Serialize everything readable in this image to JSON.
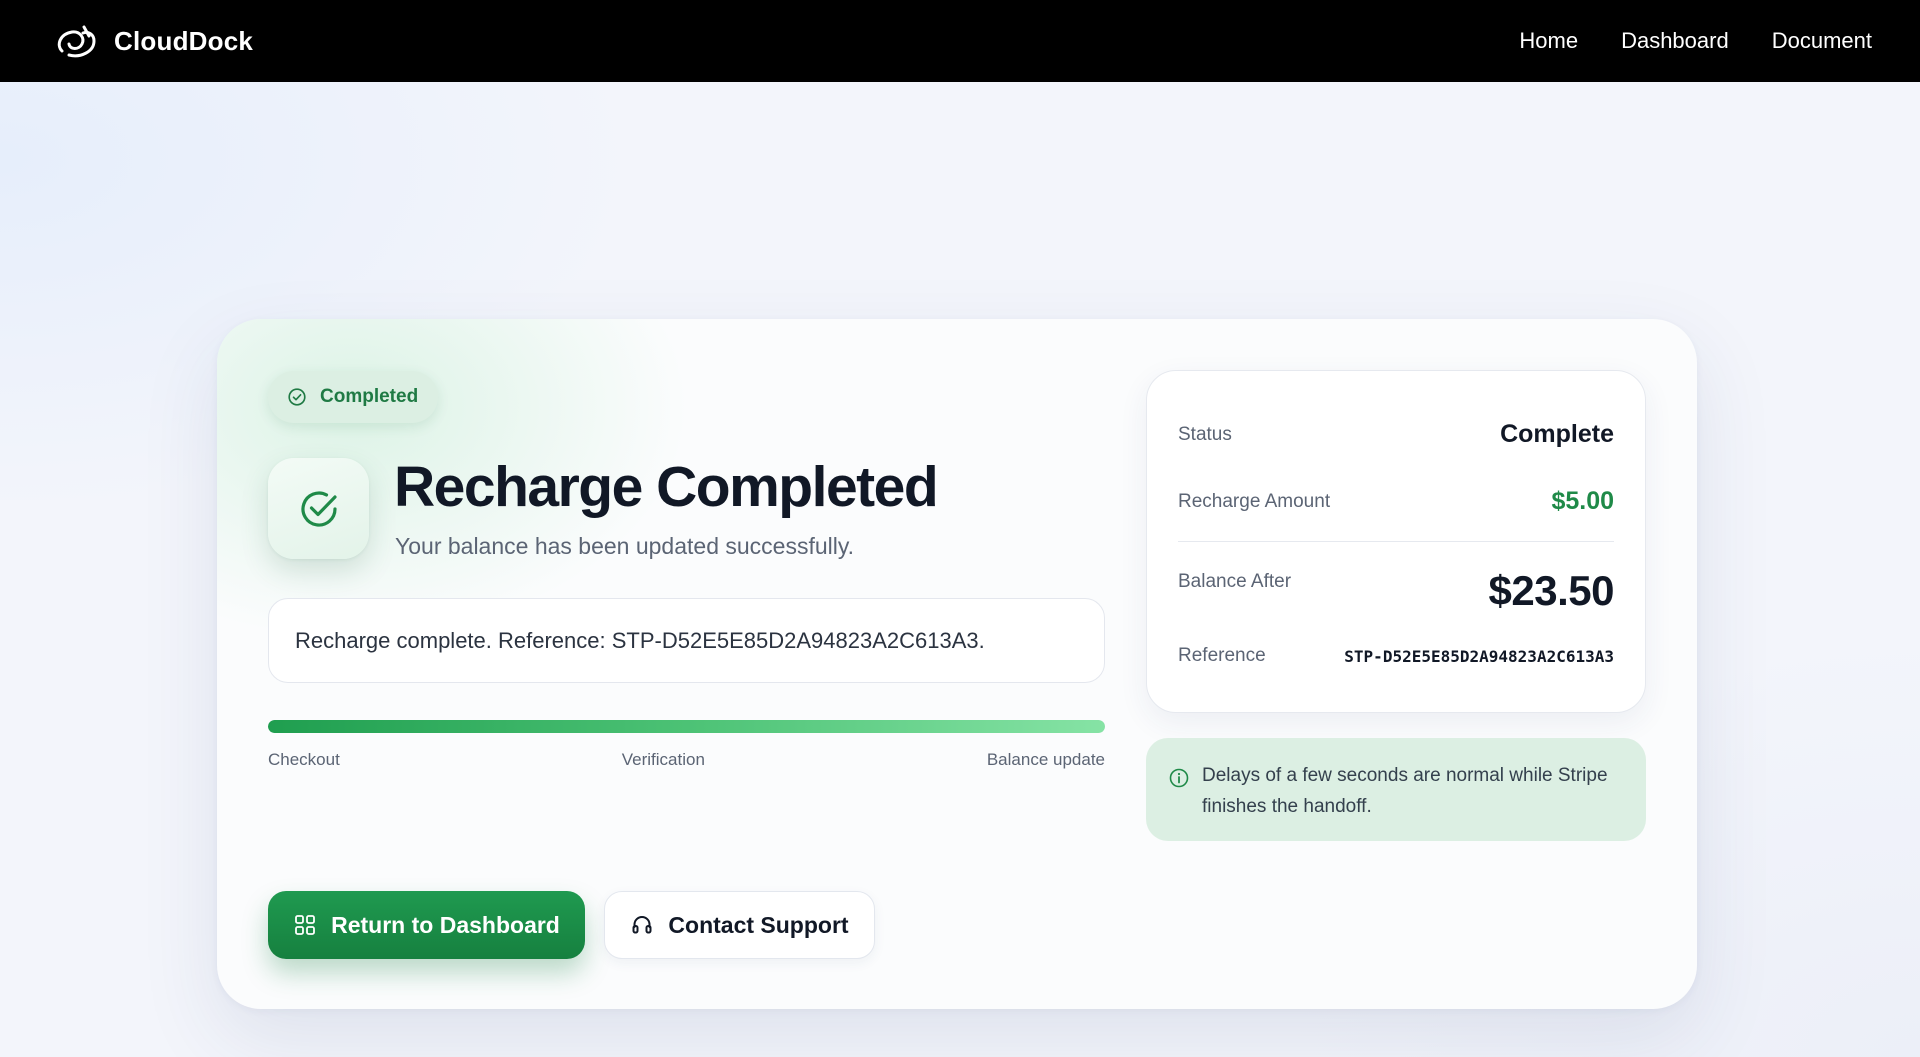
{
  "nav": {
    "brand": "CloudDock",
    "links": [
      "Home",
      "Dashboard",
      "Document"
    ]
  },
  "status_badge": {
    "label": "Completed",
    "icon": "check-circle-icon"
  },
  "hero": {
    "icon": "check-circle-icon",
    "title": "Recharge Completed",
    "subtitle": "Your balance has been updated successfully."
  },
  "message": "Recharge complete. Reference: STP-D52E5E85D2A94823A2C613A3.",
  "progress": {
    "percent": 100,
    "steps": [
      "Checkout",
      "Verification",
      "Balance update"
    ]
  },
  "actions": {
    "primary": {
      "label": "Return to Dashboard",
      "icon": "grid-icon"
    },
    "secondary": {
      "label": "Contact Support",
      "icon": "headset-icon"
    }
  },
  "summary": {
    "status_label": "Status",
    "status_value": "Complete",
    "amount_label": "Recharge Amount",
    "amount_value": "$5.00",
    "balance_label": "Balance After",
    "balance_value": "$23.50",
    "reference_label": "Reference",
    "reference_value": "STP-D52E5E85D2A94823A2C613A3"
  },
  "notice": {
    "icon": "info-icon",
    "text": "Delays of a few seconds are normal while Stripe finishes the handoff."
  },
  "colors": {
    "accent_green": "#1f8a48",
    "button_green": "#16803f",
    "badge_bg": "#dcefe3",
    "nav_bg": "#000000"
  }
}
